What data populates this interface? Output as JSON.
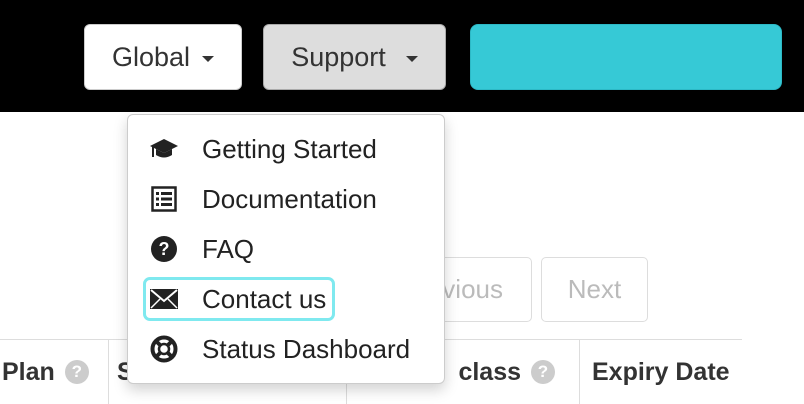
{
  "topbar": {
    "global_label": "Global",
    "support_label": "Support",
    "accent_color": "#36c9d6"
  },
  "support_menu": {
    "items": [
      {
        "label": "Getting Started",
        "icon": "graduation-cap-icon"
      },
      {
        "label": "Documentation",
        "icon": "list-alt-icon"
      },
      {
        "label": "FAQ",
        "icon": "question-circle-icon"
      },
      {
        "label": "Contact us",
        "icon": "envelope-icon"
      },
      {
        "label": "Status Dashboard",
        "icon": "life-ring-icon"
      }
    ]
  },
  "pagination": {
    "previous_label": "vious",
    "next_label": "Next"
  },
  "table": {
    "headers": [
      "Plan",
      "S",
      "class",
      "Expiry Date"
    ]
  }
}
